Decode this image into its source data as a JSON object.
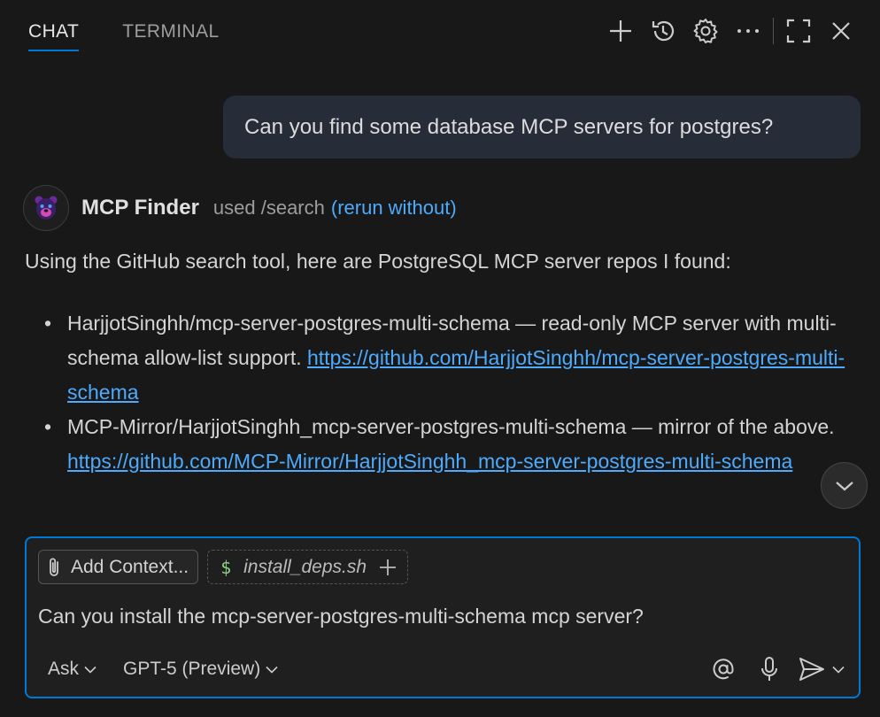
{
  "tabs": [
    {
      "label": "CHAT",
      "active": true
    },
    {
      "label": "TERMINAL",
      "active": false
    }
  ],
  "toolbar": {
    "icons": [
      "plus-icon",
      "history-icon",
      "gear-icon",
      "more-icon",
      "maximize-icon",
      "close-icon"
    ]
  },
  "user_message": "Can you find some database MCP servers for postgres?",
  "assistant": {
    "name": "MCP Finder",
    "used": "used /search",
    "rerun": "(rerun without)",
    "intro": "Using the GitHub search tool, here are PostgreSQL MCP server repos I found:",
    "results": [
      {
        "text": "HarjjotSinghh/mcp-server-postgres-multi-schema — read-only MCP server with multi-schema allow-list support. ",
        "url": "https://github.com/HarjjotSinghh/mcp-server-postgres-multi-schema"
      },
      {
        "text": "MCP-Mirror/HarjjotSinghh_mcp-server-postgres-multi-schema — mirror of the above. ",
        "url": "https://github.com/MCP-Mirror/HarjjotSinghh_mcp-server-postgres-multi-schema"
      }
    ]
  },
  "input": {
    "add_context": "Add Context...",
    "attachment": "install_deps.sh",
    "value": "Can you install the mcp-server-postgres-multi-schema mcp server?",
    "mode": "Ask",
    "model": "GPT-5 (Preview)"
  },
  "colors": {
    "accent": "#0078d4",
    "link": "#4daafc",
    "background": "#181818",
    "user_bubble": "#262d38"
  }
}
